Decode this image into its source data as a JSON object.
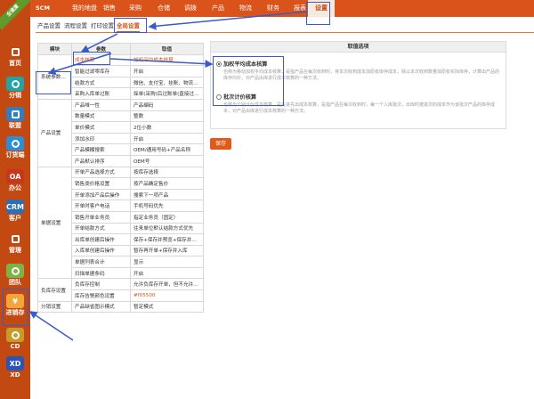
{
  "corner_ribbon": "全速度",
  "top_nav": [
    "SCM",
    "我的地盘",
    "销售",
    "采购",
    "仓储",
    "调拨",
    "产品",
    "物流",
    "财务",
    "报表",
    "设置"
  ],
  "top_nav_active": "设置",
  "sub_nav": [
    "产品设置",
    "流程设置",
    "打印设置",
    "全局设置"
  ],
  "sub_nav_active": "全局设置",
  "sidebar": [
    {
      "label": "首页",
      "icon": "home-icon",
      "color": "#c24a12"
    },
    {
      "label": "分销",
      "icon": "distribution-icon",
      "color": "#22a3a6"
    },
    {
      "label": "联盟",
      "icon": "alliance-icon",
      "color": "#2f7fc0"
    },
    {
      "label": "订货端",
      "icon": "order-icon",
      "color": "#2a8fd8"
    },
    {
      "label": "办公",
      "icon": "oa-icon",
      "color": "#c9361e",
      "glyph": "OA"
    },
    {
      "label": "客户",
      "icon": "crm-icon",
      "color": "#2b6fb6",
      "glyph": "CRM"
    },
    {
      "label": "管理",
      "icon": "gear-icon",
      "color": "#c24a12"
    },
    {
      "label": "团队",
      "icon": "team-icon",
      "color": "#7cb342"
    },
    {
      "label": "进销存",
      "icon": "yen-icon",
      "color": "#f3a43a",
      "glyph": "¥"
    },
    {
      "label": "CD",
      "icon": "cd-icon",
      "color": "#c89a2a"
    },
    {
      "label": "XD",
      "icon": "xd-icon",
      "color": "#2a55b6",
      "glyph": "XD"
    }
  ],
  "table": {
    "headers": [
      "模块",
      "参数",
      "取值"
    ],
    "groups": [
      {
        "name": "系统参数设置",
        "rows": [
          [
            "成本核算",
            "加权平均成本核算"
          ],
          [
            "智能过滤零库存",
            "开启"
          ],
          [
            "结款方式",
            "微信、支付宝、挂账、物流代收"
          ],
          [
            "采购入库单过账",
            "採单(采购)后过账单(直接过账)"
          ]
        ]
      },
      {
        "name": "产品设置",
        "rows": [
          [
            "产品唯一性",
            "产品编码"
          ],
          [
            "数量模式",
            "整数"
          ],
          [
            "单价模式",
            "2位小数"
          ],
          [
            "添加水印",
            "开启"
          ],
          [
            "产品模糊搜索",
            "OEM/通用号码+产品名称"
          ],
          [
            "产品默认排序",
            "OEM号"
          ]
        ]
      },
      {
        "name": "单据设置",
        "rows": [
          [
            "开单产品选择方式",
            "按库存选择"
          ],
          [
            "销售类价格设置",
            "按产品确定售价"
          ],
          [
            "开单添加产品后操作",
            "搜索下一项产品"
          ],
          [
            "开单时客户电话",
            "手机号码优先"
          ],
          [
            "销售开单业务员",
            "指定业务员（固定）"
          ],
          [
            "开单结款方式",
            "往来单位默认结款方式优先"
          ],
          [
            "出库单创建后操作",
            "保存+保存并预览+保存并出库"
          ],
          [
            "入库单创建后操作",
            "暂存再开单+保存并入库"
          ],
          [
            "单据列表合计",
            "显示"
          ],
          [
            "扫描单据条码",
            "开启"
          ]
        ]
      },
      {
        "name": "负库存设置",
        "rows": [
          [
            "负库存控制",
            "允许负库存开单，但不允许出库"
          ],
          [
            "库存告警颜色设置",
            "#f05500"
          ]
        ]
      },
      {
        "name": "分销设置",
        "rows": [
          [
            "产品缺省图示模式",
            "暂定模式"
          ]
        ]
      }
    ]
  },
  "panel": {
    "title": "取值选项",
    "options": [
      {
        "label": "加权平均成本核算",
        "selected": true,
        "desc": "也称为移动加权平均成本核算，是指产品在每次收到时，将本次收到成本加原有库存成本，除以本次收到数量加原有实际库存，计算出产品的库存均价，对产品出库进行成本核算的一种方法。"
      },
      {
        "label": "批次计价核算",
        "selected": false,
        "desc": "也称为个别计价成本核算，是先进先出成本核算，是指产品在每次收到时，每一个入库批次，出库时按批次的成本作为该批次产品的库存成本，对产品出库进行成本核算的一种方法。"
      }
    ]
  },
  "save_label": "保存"
}
